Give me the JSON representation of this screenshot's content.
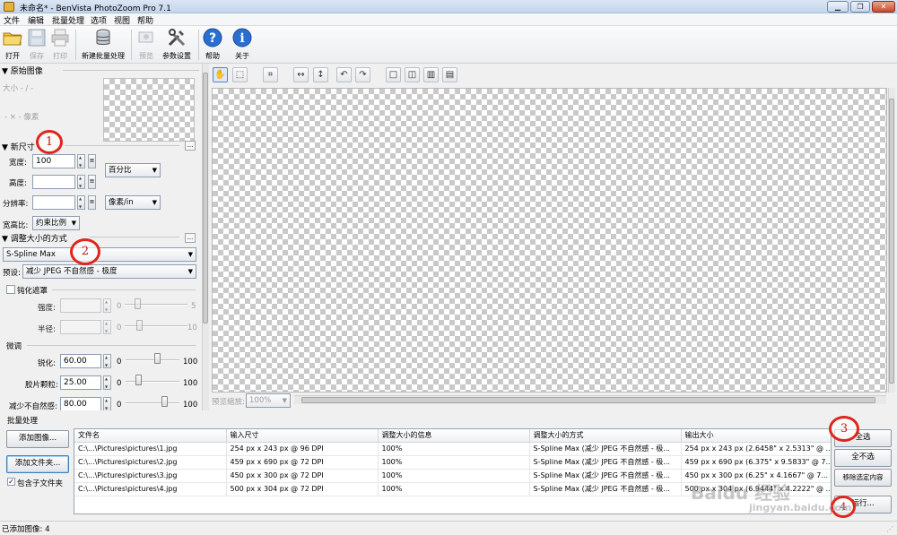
{
  "window": {
    "title": "未命名* - BenVista PhotoZoom Pro 7.1"
  },
  "menu": [
    "文件",
    "编辑",
    "批量处理",
    "选项",
    "视图",
    "帮助"
  ],
  "toolbar": {
    "open": "打开",
    "save": "保存",
    "print": "打印",
    "new_batch": "新建批量处理",
    "preview": "预览",
    "settings": "参数设置",
    "help": "帮助",
    "about": "关于"
  },
  "original": {
    "header": "▼ 原始图像",
    "size": "大小 - / -",
    "pixels": "- × - 像素"
  },
  "newsize": {
    "header": "▼ 新尺寸",
    "width_label": "宽度:",
    "width_value": "100",
    "height_label": "高度:",
    "height_value": "",
    "res_label": "分辨率:",
    "res_value": "",
    "unit": "百分比",
    "res_unit": "像素/in",
    "aspect_label": "宽高比:",
    "aspect_value": "约束比例"
  },
  "resize": {
    "header": "▼ 调整大小的方式",
    "method": "S-Spline Max",
    "preset_label": "预设:",
    "preset_value": "减少 JPEG 不自然感 - 极度",
    "unsharp_label": "钝化遮罩",
    "strength_label": "强度:",
    "strength_min": "0",
    "strength_max": "5",
    "radius_label": "半径:",
    "radius_min": "0",
    "radius_max": "10",
    "finetune_label": "微调",
    "sharpen_label": "锐化:",
    "sharpen_value": "60.00",
    "sharpen_min": "0",
    "sharpen_max": "100",
    "grain_label": "胶片颗粒:",
    "grain_value": "25.00",
    "grain_min": "0",
    "grain_max": "100",
    "artifact_label": "减少不自然感:",
    "artifact_value": "80.00",
    "artifact_min": "0",
    "artifact_max": "100"
  },
  "preview": {
    "zoom_label": "预览缩放:",
    "zoom_value": "100%"
  },
  "batch": {
    "header": "批量处理",
    "add_image": "添加图像...",
    "add_folder": "添加文件夹...",
    "include_sub": "包含子文件夹",
    "select_all": "全选",
    "select_none": "全不选",
    "remove_selected": "移除选定内容",
    "run": "运行...",
    "columns": [
      "文件名",
      "输入尺寸",
      "调整大小的信息",
      "调整大小的方式",
      "输出大小"
    ],
    "rows": [
      [
        "C:\\...\\Pictures\\pictures\\1.jpg",
        "254 px x 243 px @ 96 DPI",
        "100%",
        "S-Spline Max (减少 JPEG 不自然感 - 极...",
        "254 px x 243 px (2.6458\" x 2.5313\" @ ..."
      ],
      [
        "C:\\...\\Pictures\\pictures\\2.jpg",
        "459 px x 690 px @ 72 DPI",
        "100%",
        "S-Spline Max (减少 JPEG 不自然感 - 极...",
        "459 px x 690 px (6.375\" x 9.5833\" @ 7..."
      ],
      [
        "C:\\...\\Pictures\\pictures\\3.jpg",
        "450 px x 300 px @ 72 DPI",
        "100%",
        "S-Spline Max (减少 JPEG 不自然感 - 极...",
        "450 px x 300 px (6.25\" x 4.1667\" @ 7..."
      ],
      [
        "C:\\...\\Pictures\\pictures\\4.jpg",
        "500 px x 304 px @ 72 DPI",
        "100%",
        "S-Spline Max (减少 JPEG 不自然感 - 极...",
        "500 px x 304 px (6.9444\" x 4.2222\" @ ..."
      ]
    ]
  },
  "status": {
    "text": "已添加图像: 4"
  },
  "annotations": {
    "c1": "1",
    "c2": "2",
    "c3": "3",
    "c4": "4"
  },
  "watermark": {
    "brand": "Baidu 经验",
    "url": "jingyan.baidu.com"
  }
}
